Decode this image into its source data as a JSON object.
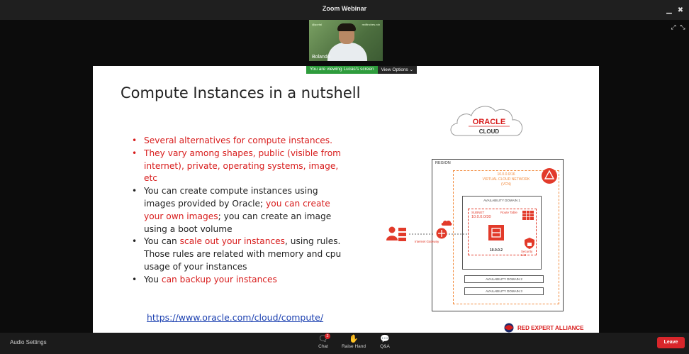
{
  "window": {
    "title": "Zoom Webinar"
  },
  "video": {
    "participant_name": "Bolando",
    "tag_left": "@portal",
    "tag_right": "redfinches.rob"
  },
  "share_banner": {
    "viewing_text": "You are viewing Lucas's screen",
    "options_label": "View Options ⌄"
  },
  "slide": {
    "title": "Compute Instances in a nutshell",
    "bullets": [
      {
        "red": true,
        "parts": [
          {
            "text": "Several alternatives for compute instances.",
            "red": true
          }
        ]
      },
      {
        "red": true,
        "parts": [
          {
            "text": "They vary among shapes, public (visible from internet), private, operating systems, image, etc",
            "red": true
          }
        ]
      },
      {
        "red": false,
        "parts": [
          {
            "text": "You can create compute instances using images provided by Oracle; ",
            "red": false
          },
          {
            "text": "you can create your own images",
            "red": true
          },
          {
            "text": "; you can create an image using a boot volume",
            "red": false
          }
        ]
      },
      {
        "red": false,
        "parts": [
          {
            "text": "You can ",
            "red": false
          },
          {
            "text": "scale out your instances",
            "red": true
          },
          {
            "text": ", using rules. Those rules are related with memory and cpu usage of your instances",
            "red": false
          }
        ]
      },
      {
        "red": false,
        "parts": [
          {
            "text": "You ",
            "red": false
          },
          {
            "text": "can backup your instances",
            "red": true
          }
        ]
      }
    ],
    "link": "https://www.oracle.com/cloud/compute/",
    "cloud_logo": {
      "line1": "ORACLE",
      "line2": "CLOUD"
    },
    "diagram": {
      "region": "REGION",
      "vcn_cidr": "10.0.0.0/16",
      "vcn_name": "VIRTUAL CLOUD NETWORK",
      "vcn_short": "(VCN)",
      "ad1": "AVAILABILITY DOMAIN 1",
      "route_table": "Route Table",
      "subnet_label": "SUBNET",
      "subnet_cidr": "10.0.0.0/30",
      "instance_ip": "10.0.0.2",
      "security_list": "Security List",
      "internet_gateway": "Internet Gateway",
      "ad2": "AVAILABILITY DOMAIN 2",
      "ad3": "AVAILABILITY DOMAIN 3"
    },
    "footer_brand": "RED EXPERT ALLIANCE"
  },
  "bottombar": {
    "audio_settings": "Audio Settings",
    "chat": "Chat",
    "chat_badge": "2",
    "raise_hand": "Raise Hand",
    "qa": "Q&A",
    "leave": "Leave"
  },
  "colors": {
    "accent_red": "#d81c1c",
    "share_green": "#2e9c3c",
    "leave_red": "#d8262b",
    "diagram_orange": "#f28a3c"
  }
}
